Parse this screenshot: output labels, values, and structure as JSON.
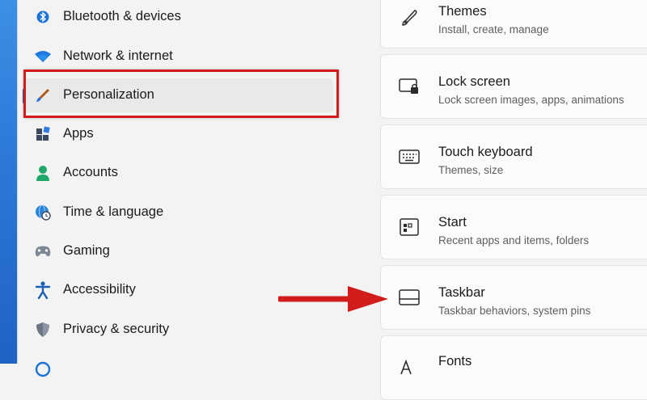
{
  "sidebar": {
    "items": [
      {
        "label": "Bluetooth & devices",
        "icon": "bluetooth-icon"
      },
      {
        "label": "Network & internet",
        "icon": "wifi-icon"
      },
      {
        "label": "Personalization",
        "icon": "brush-icon",
        "selected": true
      },
      {
        "label": "Apps",
        "icon": "apps-icon"
      },
      {
        "label": "Accounts",
        "icon": "person-icon"
      },
      {
        "label": "Time & language",
        "icon": "globe-clock-icon"
      },
      {
        "label": "Gaming",
        "icon": "gamepad-icon"
      },
      {
        "label": "Accessibility",
        "icon": "accessibility-icon"
      },
      {
        "label": "Privacy & security",
        "icon": "shield-icon"
      }
    ]
  },
  "settings": {
    "cards": [
      {
        "title": "Themes",
        "subtitle": "Install, create, manage",
        "icon": "pen-icon"
      },
      {
        "title": "Lock screen",
        "subtitle": "Lock screen images, apps, animations",
        "icon": "lock-screen-icon"
      },
      {
        "title": "Touch keyboard",
        "subtitle": "Themes, size",
        "icon": "keyboard-icon"
      },
      {
        "title": "Start",
        "subtitle": "Recent apps and items, folders",
        "icon": "start-icon"
      },
      {
        "title": "Taskbar",
        "subtitle": "Taskbar behaviors, system pins",
        "icon": "taskbar-icon"
      },
      {
        "title": "Fonts",
        "subtitle": "",
        "icon": "fonts-icon"
      }
    ]
  },
  "annotations": {
    "highlight_color": "#d21b1b",
    "accent": "#1a5fb4"
  }
}
